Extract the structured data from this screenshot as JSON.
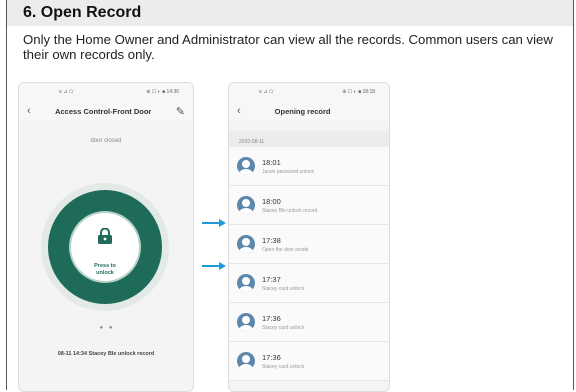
{
  "section": {
    "heading": "6. Open Record",
    "description": "Only the Home Owner and Administrator can view all the records. Common users can view their own records only."
  },
  "left_phone": {
    "status_left": "≡ ⊿ ☖",
    "status_right": "⊕ ☐ ◐ ■ 14:36",
    "title": "Access Control-Front Door",
    "door_state": "door closed",
    "unlock_line1": "Press to",
    "unlock_line2": "unlock",
    "page_dots": "● ●",
    "last_record": "08-11 14:34 Stacey Ble unlock record"
  },
  "right_phone": {
    "status_left": "≡ ⊿ ☖",
    "status_right": "⊕ ☐ ◐ ■ 18:18",
    "title": "Opening record",
    "date": "2020-08-11",
    "records": [
      {
        "time": "18:01",
        "desc": "Jason password unlock"
      },
      {
        "time": "18:00",
        "desc": "Stacey Ble unlock record"
      },
      {
        "time": "17:38",
        "desc": "Open the door inside"
      },
      {
        "time": "17:37",
        "desc": "Stacey card unlock"
      },
      {
        "time": "17:36",
        "desc": "Stacey card unlock"
      },
      {
        "time": "17:36",
        "desc": "Stacey card unlock"
      }
    ]
  },
  "colors": {
    "accent": "#1f6b5a",
    "arrow": "#1e9ad6",
    "avatar": "#5d87ab"
  },
  "icons": {
    "back": "chevron-left-icon",
    "edit": "pencil-icon",
    "lock": "lock-icon",
    "avatar": "user-avatar-icon",
    "arrow": "arrow-right-icon"
  }
}
